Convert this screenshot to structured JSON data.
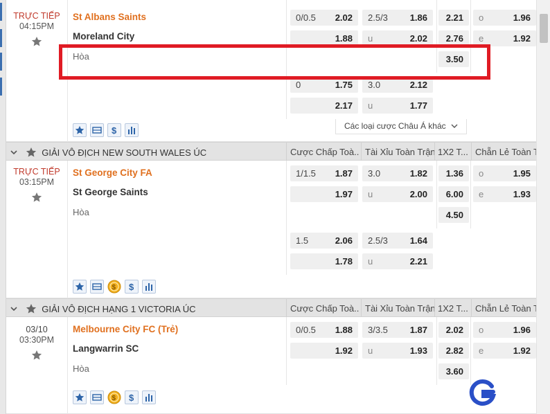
{
  "matches": [
    {
      "status": "TRỰC TIẾP",
      "time": "04:15PM",
      "home": "St Albans Saints",
      "away": "Moreland City",
      "draw": "Hòa",
      "lines": [
        {
          "hc_label": "0/0.5",
          "hc_home": "2.02",
          "hc_away": "1.88",
          "ou_label": "2.5/3",
          "ou_over": "1.86",
          "ou_u": "u",
          "ou_under": "2.02",
          "x12_home": "2.21",
          "x12_away": "2.76",
          "x12_draw": "3.50",
          "oe_o": "o",
          "oe_o_val": "1.96",
          "oe_e": "e",
          "oe_e_val": "1.92"
        },
        {
          "hc_label": "0",
          "hc_home": "1.75",
          "hc_away": "2.17",
          "ou_label": "3.0",
          "ou_over": "2.12",
          "ou_u": "u",
          "ou_under": "1.77"
        }
      ],
      "more_label": "Các loại cược Châu Á khác"
    },
    {
      "status": "TRỰC TIẾP",
      "time": "03:15PM",
      "home": "St George City FA",
      "away": "St George Saints",
      "draw": "Hòa",
      "lines": [
        {
          "hc_label": "1/1.5",
          "hc_home": "1.87",
          "hc_away": "1.97",
          "ou_label": "3.0",
          "ou_over": "1.82",
          "ou_u": "u",
          "ou_under": "2.00",
          "x12_home": "1.36",
          "x12_away": "6.00",
          "x12_draw": "4.50",
          "oe_o": "o",
          "oe_o_val": "1.95",
          "oe_e": "e",
          "oe_e_val": "1.93"
        },
        {
          "hc_label": "1.5",
          "hc_home": "2.06",
          "hc_away": "1.78",
          "ou_label": "2.5/3",
          "ou_over": "1.64",
          "ou_u": "u",
          "ou_under": "2.21"
        }
      ]
    },
    {
      "status": "03/10",
      "time": "03:30PM",
      "home": "Melbourne City FC (Trẻ)",
      "away": "Langwarrin SC",
      "draw": "Hòa",
      "lines": [
        {
          "hc_label": "0/0.5",
          "hc_home": "1.88",
          "hc_away": "1.92",
          "ou_label": "3/3.5",
          "ou_over": "1.87",
          "ou_u": "u",
          "ou_under": "1.93",
          "x12_home": "2.02",
          "x12_away": "2.82",
          "x12_draw": "3.60",
          "oe_o": "o",
          "oe_o_val": "1.96",
          "oe_e": "e",
          "oe_e_val": "1.92"
        }
      ]
    }
  ],
  "leagues": [
    {
      "name": "GIẢI VÔ ĐỊCH NEW SOUTH WALES ÚC",
      "col_hc": "Cược Chấp Toà...",
      "col_ou": "Tài Xỉu Toàn Trận",
      "col_x12": "1X2 T...",
      "col_oe": "Chẵn Lẻ Toàn T"
    },
    {
      "name": "GIẢI VÔ ĐỊCH HẠNG 1 VICTORIA ÚC",
      "col_hc": "Cược Chấp Toà...",
      "col_ou": "Tài Xỉu Toàn Trận",
      "col_x12": "1X2 T...",
      "col_oe": "Chẵn Lẻ Toàn T"
    }
  ],
  "icons": {
    "accent": "#3b6fb0",
    "home_team_color": "#e0701f",
    "live_color": "#c0392b",
    "highlight_color": "#e01b24"
  }
}
